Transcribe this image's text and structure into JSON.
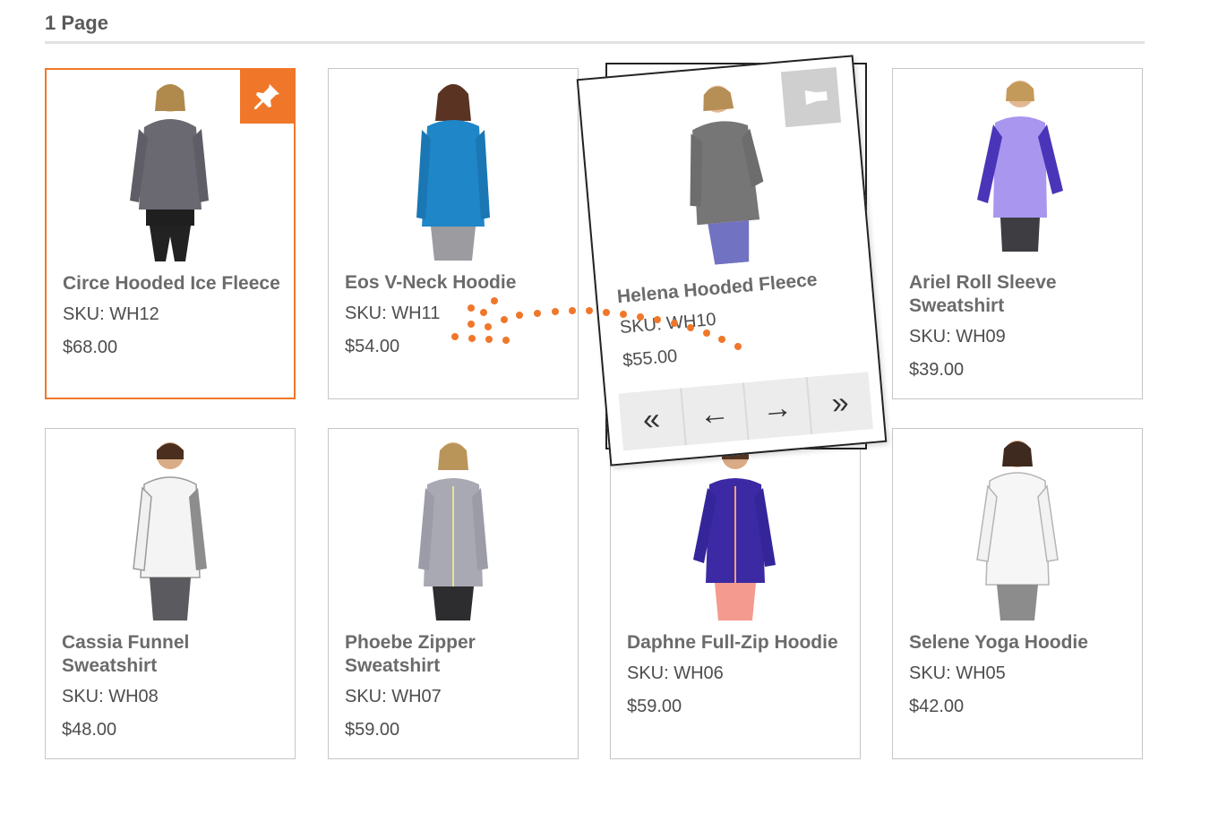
{
  "header": {
    "title": "1 Page"
  },
  "colors": {
    "accent": "#f0772a",
    "border": "#c6c6c6",
    "text": "#4d4d4d"
  },
  "products": [
    {
      "name": "Circe Hooded Ice Fleece",
      "sku": "SKU: WH12",
      "price": "$68.00",
      "image": "woman-charcoal-hooded-fleece",
      "pinned": true
    },
    {
      "name": "Eos V-Neck Hoodie",
      "sku": "SKU: WH11",
      "price": "$54.00",
      "image": "woman-blue-vneck-hoodie"
    },
    {
      "name": "Ariel Roll Sleeve Sweatshirt",
      "sku": "SKU: WH09",
      "price": "$39.00",
      "image": "woman-lavender-raglan-sweatshirt"
    },
    {
      "name": "Cassia Funnel Sweatshirt",
      "sku": "SKU: WH08",
      "price": "$48.00",
      "image": "woman-white-funnel-sweatshirt"
    },
    {
      "name": "Phoebe Zipper Sweatshirt",
      "sku": "SKU: WH07",
      "price": "$59.00",
      "image": "woman-grey-zip-sweatshirt"
    },
    {
      "name": "Daphne Full-Zip Hoodie",
      "sku": "SKU: WH06",
      "price": "$59.00",
      "image": "woman-indigo-zip-hoodie"
    },
    {
      "name": "Selene Yoga Hoodie",
      "sku": "SKU: WH05",
      "price": "$42.00",
      "image": "woman-white-yoga-hoodie"
    }
  ],
  "dragged": {
    "name": "Helena Hooded Fleece",
    "sku": "SKU: WH10",
    "price": "$55.00",
    "image": "woman-grey-hooded-fleece",
    "pin_icon": "pushpin-icon",
    "pager": {
      "first": "«",
      "prev": "←",
      "next": "→",
      "last": "»"
    }
  }
}
